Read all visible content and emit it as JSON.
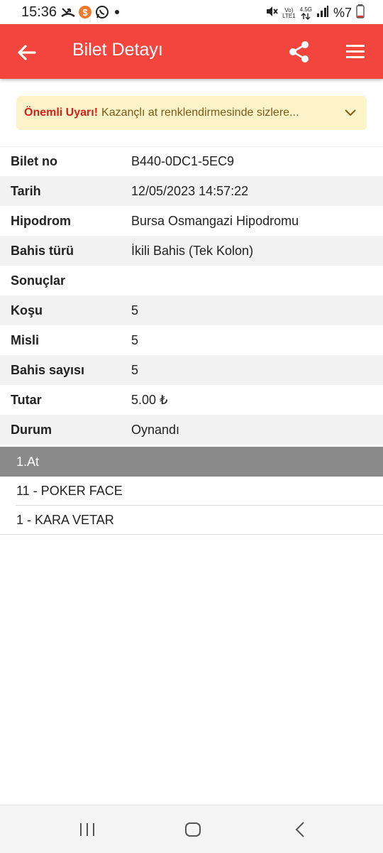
{
  "status_bar": {
    "time": "15:36",
    "network_top": "Vo)",
    "network_bottom": "LTE1",
    "data_type": "4.5G",
    "battery": "%7"
  },
  "app_bar": {
    "title": "Bilet Detayı",
    "back_icon": "arrow-left",
    "share_icon": "share",
    "menu_icon": "hamburger-menu"
  },
  "warning": {
    "label": "Önemli Uyarı!",
    "message": "Kazançlı at renklendirmesinde sizlere..."
  },
  "details": [
    {
      "key": "Bilet no",
      "value": "B440-0DC1-5EC9"
    },
    {
      "key": "Tarih",
      "value": "12/05/2023 14:57:22"
    },
    {
      "key": "Hipodrom",
      "value": "Bursa Osmangazi Hipodromu"
    },
    {
      "key": "Bahis türü",
      "value": "İkili Bahis (Tek Kolon)"
    },
    {
      "key": "Sonuçlar",
      "value": ""
    },
    {
      "key": "Koşu",
      "value": "5"
    },
    {
      "key": "Misli",
      "value": "5"
    },
    {
      "key": "Bahis sayısı",
      "value": "5"
    },
    {
      "key": "Tutar",
      "value": "5.00 ₺"
    },
    {
      "key": "Durum",
      "value": "Oynandı"
    }
  ],
  "horses": {
    "header": "1.At",
    "items": [
      "11 - POKER FACE",
      "1 - KARA VETAR"
    ]
  },
  "colors": {
    "accent": "#f2453d",
    "warning_bg": "#fdf3c9",
    "warning_label": "#d3201a",
    "section_header": "#8a8a8a"
  }
}
